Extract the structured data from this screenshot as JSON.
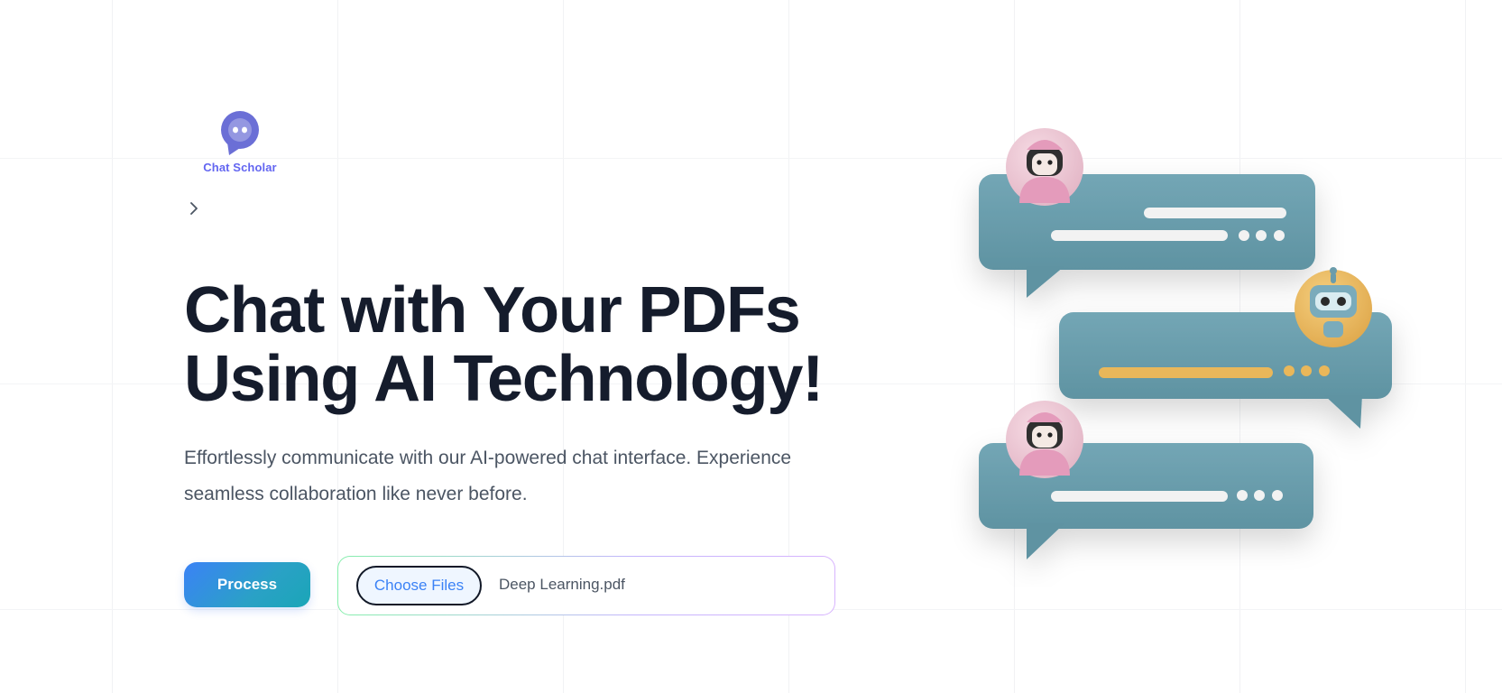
{
  "brand": {
    "name": "Chat Scholar",
    "color": "#6366f1"
  },
  "hero": {
    "title_line1": "Chat with Your PDFs",
    "title_line2": "Using AI Technology!",
    "subtitle_line1": "Effortlessly communicate with our AI-powered chat interface. Experience",
    "subtitle_line2": "seamless collaboration like never before."
  },
  "actions": {
    "process_label": "Process",
    "choose_files_label": "Choose Files",
    "selected_file": "Deep Learning.pdf"
  },
  "icons": {
    "logo": "chat-bubble-logo-icon",
    "nav": "chevron-right-icon",
    "illustration": "chat-bubbles-illustration"
  },
  "colors": {
    "bubble": "#6a9cab",
    "bot_avatar": "#e9b75a",
    "user_avatar": "#e7a7c1",
    "accent_blue": "#3b82f6"
  }
}
